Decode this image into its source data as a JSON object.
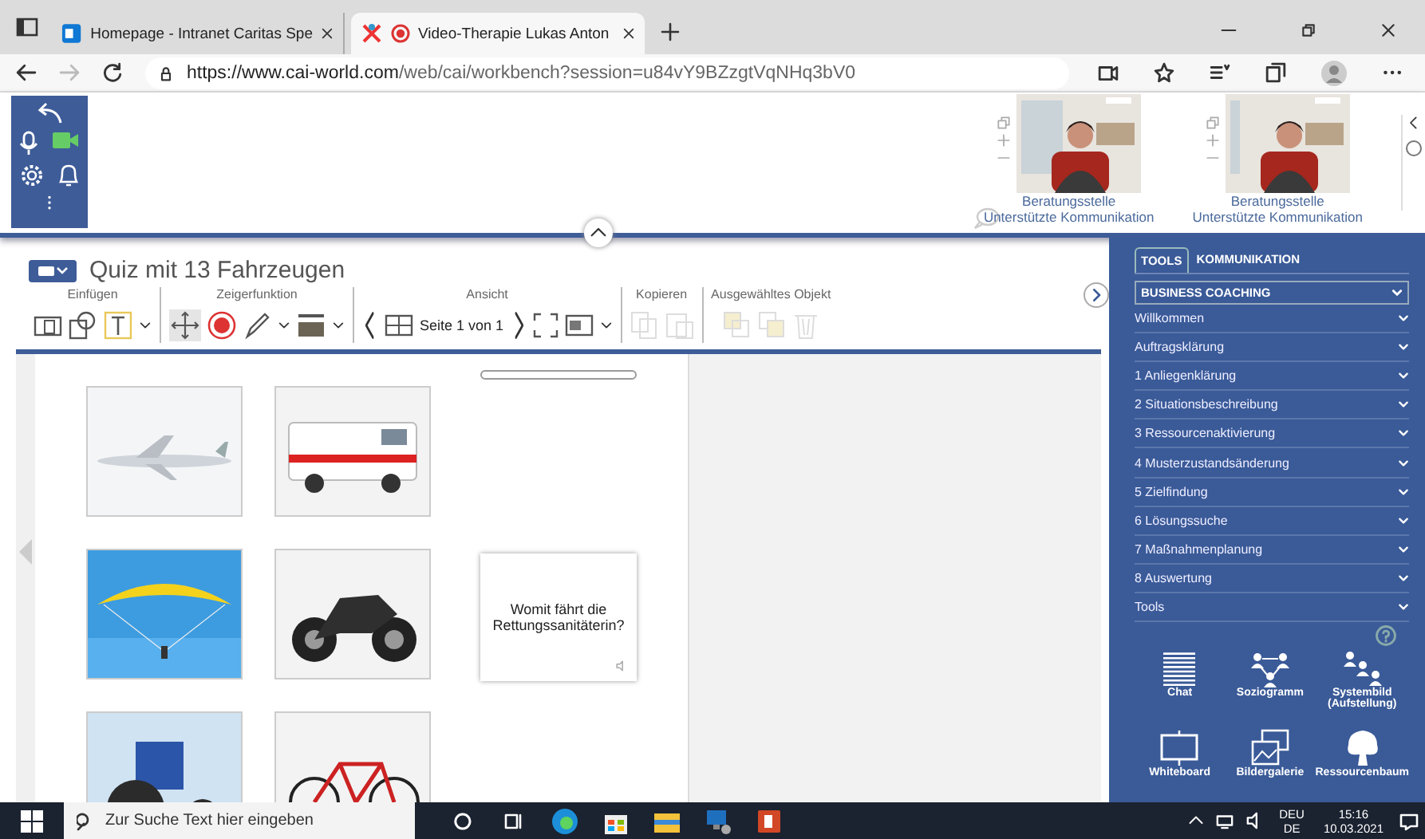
{
  "browser": {
    "tabs": [
      {
        "title": "Homepage - Intranet Caritas Spe",
        "selected": false
      },
      {
        "title": "Video-Therapie Lukas Anton",
        "selected": true
      }
    ],
    "url_host": "https://www.cai-world.com",
    "url_path": "/web/cai/workbench?session=u84vY9BZzgtVqNHq3bV0"
  },
  "videos": [
    {
      "line1": "Beratungsstelle",
      "line2": "Unterstützte Kommunikation"
    },
    {
      "line1": "Beratungsstelle",
      "line2": "Unterstützte Kommunikation"
    }
  ],
  "workspace": {
    "title": "Quiz mit 13 Fahrzeugen",
    "groups": [
      "Einfügen",
      "Zeigerfunktion",
      "Ansicht",
      "Kopieren",
      "Ausgewähltes Objekt"
    ],
    "page": "Seite 1 von 1",
    "progress": {
      "level": 0
    },
    "tiles": [
      {
        "kind": "picture"
      },
      {
        "kind": "picture"
      },
      {
        "kind": "picture"
      },
      {
        "kind": "picture"
      },
      {
        "kind": "picture"
      },
      {
        "kind": "picture"
      }
    ],
    "question": "Womit fährt die Rettungssanitäterin?"
  },
  "panel": {
    "tabs": [
      {
        "label": "TOOLS",
        "selected": true
      },
      {
        "label": "KOMMUNIKATION",
        "selected": false
      }
    ],
    "dropdown": "BUSINESS COACHING",
    "items": [
      "Willkommen",
      "Auftragsklärung",
      "1 Anliegenklärung",
      "2 Situationsbeschreibung",
      "3 Ressourcenaktivierung",
      "4 Musterzustandsänderung",
      "5 Zielfindung",
      "6 Lösungssuche",
      "7 Maßnahmenplanung",
      "8 Auswertung",
      "Tools"
    ],
    "tools": [
      {
        "kind": "chat",
        "label": "Chat"
      },
      {
        "kind": "sozio",
        "label": "Soziogramm"
      },
      {
        "kind": "system",
        "label": "Systembild (Aufstellung)"
      },
      {
        "kind": "whiteboard",
        "label": "Whiteboard"
      },
      {
        "kind": "gallery",
        "label": "Bildergalerie"
      },
      {
        "kind": "tree",
        "label": "Ressourcenbaum"
      }
    ]
  },
  "taskbar": {
    "search": {
      "placeholder": "Zur Suche Text hier eingeben"
    },
    "lang1": "DEU",
    "lang2": "DE",
    "time": "15:16",
    "date": "10.03.2021"
  }
}
